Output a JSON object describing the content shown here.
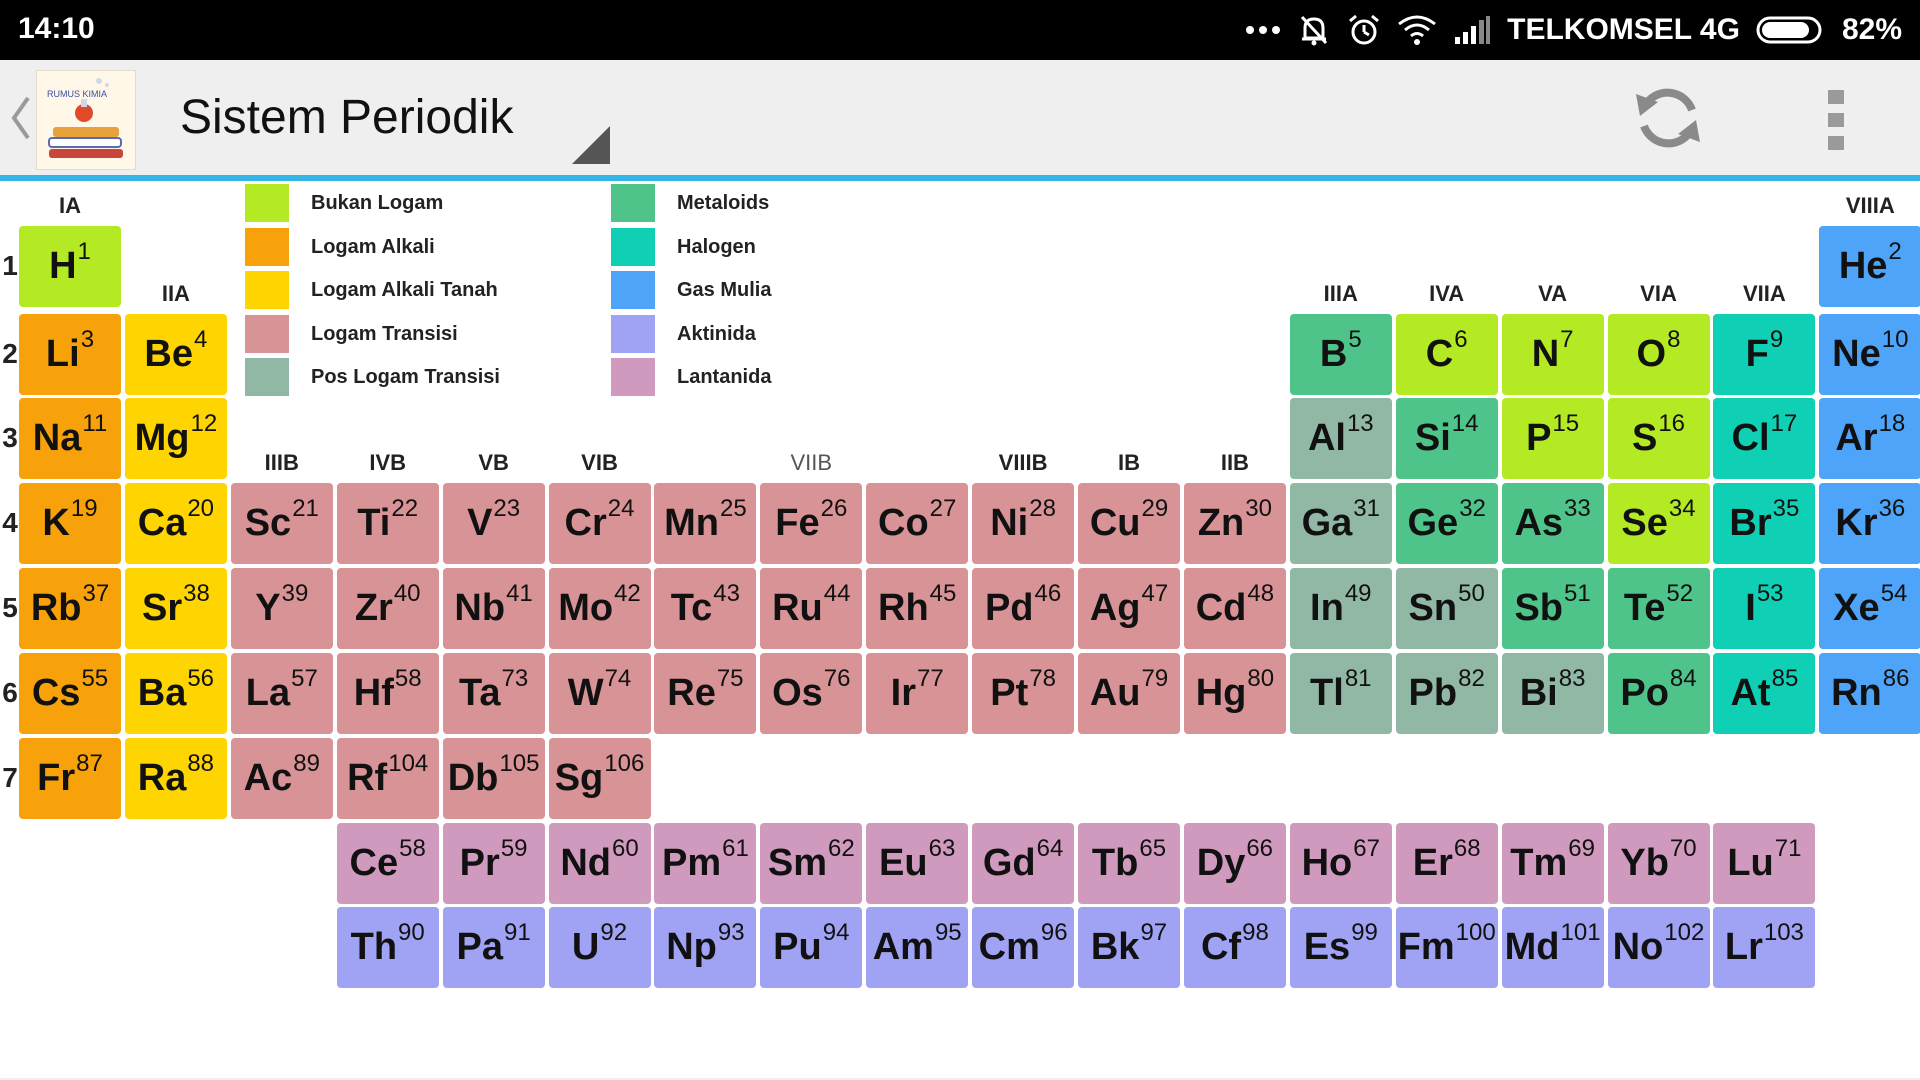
{
  "status_bar": {
    "time": "14:10",
    "carrier": "TELKOMSEL 4G",
    "battery": "82%",
    "icons": [
      "more-dots-icon",
      "mute-bell-icon",
      "alarm-icon",
      "wifi-icon",
      "signal-icon",
      "battery-icon"
    ]
  },
  "action_bar": {
    "title": "Sistem Periodik",
    "logo_text": "RUMUS KIMIA",
    "icons": [
      "back-chevron-icon",
      "app-logo",
      "spinner-triangle-icon",
      "refresh-icon",
      "overflow-menu-icon"
    ]
  },
  "colors": {
    "nonmetal": "#b4ea23",
    "alkali": "#f7a20a",
    "alkaline": "#fed401",
    "transition": "#d89396",
    "post": "#91b8a5",
    "metalloid": "#4fc48a",
    "halogen": "#0fd0b4",
    "noble": "#4ea4f8",
    "actinide": "#a0a2f4",
    "lanthanide": "#d09abe",
    "accent": "#33b5e5"
  },
  "legend": [
    {
      "key": "nonmetal",
      "label": "Bukan Logam"
    },
    {
      "key": "alkali",
      "label": "Logam Alkali"
    },
    {
      "key": "alkaline",
      "label": "Logam Alkali Tanah"
    },
    {
      "key": "transition",
      "label": "Logam Transisi"
    },
    {
      "key": "post",
      "label": "Pos Logam Transisi"
    },
    {
      "key": "metalloid",
      "label": "Metaloids"
    },
    {
      "key": "halogen",
      "label": "Halogen"
    },
    {
      "key": "noble",
      "label": "Gas Mulia"
    },
    {
      "key": "actinide",
      "label": "Aktinida"
    },
    {
      "key": "lanthanide",
      "label": "Lantanida"
    }
  ],
  "group_labels": [
    {
      "col": 1,
      "row": 1,
      "label": "IA"
    },
    {
      "col": 2,
      "row": 2,
      "label": "IIA"
    },
    {
      "col": 3,
      "row": 4,
      "label": "IIIB"
    },
    {
      "col": 4,
      "row": 4,
      "label": "IVB"
    },
    {
      "col": 5,
      "row": 4,
      "label": "VB"
    },
    {
      "col": 6,
      "row": 4,
      "label": "VIB"
    },
    {
      "col": 8,
      "row": 4,
      "label": "VIIB"
    },
    {
      "col": 10,
      "row": 4,
      "label": "VIIIB"
    },
    {
      "col": 11,
      "row": 4,
      "label": "IB"
    },
    {
      "col": 12,
      "row": 4,
      "label": "IIB"
    },
    {
      "col": 13,
      "row": 2,
      "label": "IIIA"
    },
    {
      "col": 14,
      "row": 2,
      "label": "IVA"
    },
    {
      "col": 15,
      "row": 2,
      "label": "VA"
    },
    {
      "col": 16,
      "row": 2,
      "label": "VIA"
    },
    {
      "col": 17,
      "row": 2,
      "label": "VIIA"
    },
    {
      "col": 18,
      "row": 1,
      "label": "VIIIA"
    }
  ],
  "periods": [
    "1",
    "2",
    "3",
    "4",
    "5",
    "6",
    "7"
  ],
  "elements": [
    {
      "s": "H",
      "n": 1,
      "col": 1,
      "row": 1,
      "c": "nonmetal"
    },
    {
      "s": "He",
      "n": 2,
      "col": 18,
      "row": 1,
      "c": "noble"
    },
    {
      "s": "Li",
      "n": 3,
      "col": 1,
      "row": 2,
      "c": "alkali"
    },
    {
      "s": "Be",
      "n": 4,
      "col": 2,
      "row": 2,
      "c": "alkaline"
    },
    {
      "s": "B",
      "n": 5,
      "col": 13,
      "row": 2,
      "c": "metalloid"
    },
    {
      "s": "C",
      "n": 6,
      "col": 14,
      "row": 2,
      "c": "nonmetal"
    },
    {
      "s": "N",
      "n": 7,
      "col": 15,
      "row": 2,
      "c": "nonmetal"
    },
    {
      "s": "O",
      "n": 8,
      "col": 16,
      "row": 2,
      "c": "nonmetal"
    },
    {
      "s": "F",
      "n": 9,
      "col": 17,
      "row": 2,
      "c": "halogen"
    },
    {
      "s": "Ne",
      "n": 10,
      "col": 18,
      "row": 2,
      "c": "noble"
    },
    {
      "s": "Na",
      "n": 11,
      "col": 1,
      "row": 3,
      "c": "alkali"
    },
    {
      "s": "Mg",
      "n": 12,
      "col": 2,
      "row": 3,
      "c": "alkaline"
    },
    {
      "s": "Al",
      "n": 13,
      "col": 13,
      "row": 3,
      "c": "post"
    },
    {
      "s": "Si",
      "n": 14,
      "col": 14,
      "row": 3,
      "c": "metalloid"
    },
    {
      "s": "P",
      "n": 15,
      "col": 15,
      "row": 3,
      "c": "nonmetal"
    },
    {
      "s": "S",
      "n": 16,
      "col": 16,
      "row": 3,
      "c": "nonmetal"
    },
    {
      "s": "Cl",
      "n": 17,
      "col": 17,
      "row": 3,
      "c": "halogen"
    },
    {
      "s": "Ar",
      "n": 18,
      "col": 18,
      "row": 3,
      "c": "noble"
    },
    {
      "s": "K",
      "n": 19,
      "col": 1,
      "row": 4,
      "c": "alkali"
    },
    {
      "s": "Ca",
      "n": 20,
      "col": 2,
      "row": 4,
      "c": "alkaline"
    },
    {
      "s": "Sc",
      "n": 21,
      "col": 3,
      "row": 4,
      "c": "transition"
    },
    {
      "s": "Ti",
      "n": 22,
      "col": 4,
      "row": 4,
      "c": "transition"
    },
    {
      "s": "V",
      "n": 23,
      "col": 5,
      "row": 4,
      "c": "transition"
    },
    {
      "s": "Cr",
      "n": 24,
      "col": 6,
      "row": 4,
      "c": "transition"
    },
    {
      "s": "Mn",
      "n": 25,
      "col": 7,
      "row": 4,
      "c": "transition"
    },
    {
      "s": "Fe",
      "n": 26,
      "col": 8,
      "row": 4,
      "c": "transition"
    },
    {
      "s": "Co",
      "n": 27,
      "col": 9,
      "row": 4,
      "c": "transition"
    },
    {
      "s": "Ni",
      "n": 28,
      "col": 10,
      "row": 4,
      "c": "transition"
    },
    {
      "s": "Cu",
      "n": 29,
      "col": 11,
      "row": 4,
      "c": "transition"
    },
    {
      "s": "Zn",
      "n": 30,
      "col": 12,
      "row": 4,
      "c": "transition"
    },
    {
      "s": "Ga",
      "n": 31,
      "col": 13,
      "row": 4,
      "c": "post"
    },
    {
      "s": "Ge",
      "n": 32,
      "col": 14,
      "row": 4,
      "c": "metalloid"
    },
    {
      "s": "As",
      "n": 33,
      "col": 15,
      "row": 4,
      "c": "metalloid"
    },
    {
      "s": "Se",
      "n": 34,
      "col": 16,
      "row": 4,
      "c": "nonmetal"
    },
    {
      "s": "Br",
      "n": 35,
      "col": 17,
      "row": 4,
      "c": "halogen"
    },
    {
      "s": "Kr",
      "n": 36,
      "col": 18,
      "row": 4,
      "c": "noble"
    },
    {
      "s": "Rb",
      "n": 37,
      "col": 1,
      "row": 5,
      "c": "alkali"
    },
    {
      "s": "Sr",
      "n": 38,
      "col": 2,
      "row": 5,
      "c": "alkaline"
    },
    {
      "s": "Y",
      "n": 39,
      "col": 3,
      "row": 5,
      "c": "transition"
    },
    {
      "s": "Zr",
      "n": 40,
      "col": 4,
      "row": 5,
      "c": "transition"
    },
    {
      "s": "Nb",
      "n": 41,
      "col": 5,
      "row": 5,
      "c": "transition"
    },
    {
      "s": "Mo",
      "n": 42,
      "col": 6,
      "row": 5,
      "c": "transition"
    },
    {
      "s": "Tc",
      "n": 43,
      "col": 7,
      "row": 5,
      "c": "transition"
    },
    {
      "s": "Ru",
      "n": 44,
      "col": 8,
      "row": 5,
      "c": "transition"
    },
    {
      "s": "Rh",
      "n": 45,
      "col": 9,
      "row": 5,
      "c": "transition"
    },
    {
      "s": "Pd",
      "n": 46,
      "col": 10,
      "row": 5,
      "c": "transition"
    },
    {
      "s": "Ag",
      "n": 47,
      "col": 11,
      "row": 5,
      "c": "transition"
    },
    {
      "s": "Cd",
      "n": 48,
      "col": 12,
      "row": 5,
      "c": "transition"
    },
    {
      "s": "In",
      "n": 49,
      "col": 13,
      "row": 5,
      "c": "post"
    },
    {
      "s": "Sn",
      "n": 50,
      "col": 14,
      "row": 5,
      "c": "post"
    },
    {
      "s": "Sb",
      "n": 51,
      "col": 15,
      "row": 5,
      "c": "metalloid"
    },
    {
      "s": "Te",
      "n": 52,
      "col": 16,
      "row": 5,
      "c": "metalloid"
    },
    {
      "s": "I",
      "n": 53,
      "col": 17,
      "row": 5,
      "c": "halogen"
    },
    {
      "s": "Xe",
      "n": 54,
      "col": 18,
      "row": 5,
      "c": "noble"
    },
    {
      "s": "Cs",
      "n": 55,
      "col": 1,
      "row": 6,
      "c": "alkali"
    },
    {
      "s": "Ba",
      "n": 56,
      "col": 2,
      "row": 6,
      "c": "alkaline"
    },
    {
      "s": "La",
      "n": 57,
      "col": 3,
      "row": 6,
      "c": "transition"
    },
    {
      "s": "Hf",
      "n": 58,
      "col": 4,
      "row": 6,
      "c": "transition"
    },
    {
      "s": "Ta",
      "n": 73,
      "col": 5,
      "row": 6,
      "c": "transition"
    },
    {
      "s": "W",
      "n": 74,
      "col": 6,
      "row": 6,
      "c": "transition"
    },
    {
      "s": "Re",
      "n": 75,
      "col": 7,
      "row": 6,
      "c": "transition"
    },
    {
      "s": "Os",
      "n": 76,
      "col": 8,
      "row": 6,
      "c": "transition"
    },
    {
      "s": "Ir",
      "n": 77,
      "col": 9,
      "row": 6,
      "c": "transition"
    },
    {
      "s": "Pt",
      "n": 78,
      "col": 10,
      "row": 6,
      "c": "transition"
    },
    {
      "s": "Au",
      "n": 79,
      "col": 11,
      "row": 6,
      "c": "transition"
    },
    {
      "s": "Hg",
      "n": 80,
      "col": 12,
      "row": 6,
      "c": "transition"
    },
    {
      "s": "Tl",
      "n": 81,
      "col": 13,
      "row": 6,
      "c": "post"
    },
    {
      "s": "Pb",
      "n": 82,
      "col": 14,
      "row": 6,
      "c": "post"
    },
    {
      "s": "Bi",
      "n": 83,
      "col": 15,
      "row": 6,
      "c": "post"
    },
    {
      "s": "Po",
      "n": 84,
      "col": 16,
      "row": 6,
      "c": "metalloid"
    },
    {
      "s": "At",
      "n": 85,
      "col": 17,
      "row": 6,
      "c": "halogen"
    },
    {
      "s": "Rn",
      "n": 86,
      "col": 18,
      "row": 6,
      "c": "noble"
    },
    {
      "s": "Fr",
      "n": 87,
      "col": 1,
      "row": 7,
      "c": "alkali"
    },
    {
      "s": "Ra",
      "n": 88,
      "col": 2,
      "row": 7,
      "c": "alkaline"
    },
    {
      "s": "Ac",
      "n": 89,
      "col": 3,
      "row": 7,
      "c": "transition"
    },
    {
      "s": "Rf",
      "n": 104,
      "col": 4,
      "row": 7,
      "c": "transition"
    },
    {
      "s": "Db",
      "n": 105,
      "col": 5,
      "row": 7,
      "c": "transition"
    },
    {
      "s": "Sg",
      "n": 106,
      "col": 6,
      "row": 7,
      "c": "transition"
    },
    {
      "s": "Ce",
      "n": 58,
      "col": 4,
      "row": 8,
      "c": "lanthanide"
    },
    {
      "s": "Pr",
      "n": 59,
      "col": 5,
      "row": 8,
      "c": "lanthanide"
    },
    {
      "s": "Nd",
      "n": 60,
      "col": 6,
      "row": 8,
      "c": "lanthanide"
    },
    {
      "s": "Pm",
      "n": 61,
      "col": 7,
      "row": 8,
      "c": "lanthanide"
    },
    {
      "s": "Sm",
      "n": 62,
      "col": 8,
      "row": 8,
      "c": "lanthanide"
    },
    {
      "s": "Eu",
      "n": 63,
      "col": 9,
      "row": 8,
      "c": "lanthanide"
    },
    {
      "s": "Gd",
      "n": 64,
      "col": 10,
      "row": 8,
      "c": "lanthanide"
    },
    {
      "s": "Tb",
      "n": 65,
      "col": 11,
      "row": 8,
      "c": "lanthanide"
    },
    {
      "s": "Dy",
      "n": 66,
      "col": 12,
      "row": 8,
      "c": "lanthanide"
    },
    {
      "s": "Ho",
      "n": 67,
      "col": 13,
      "row": 8,
      "c": "lanthanide"
    },
    {
      "s": "Er",
      "n": 68,
      "col": 14,
      "row": 8,
      "c": "lanthanide"
    },
    {
      "s": "Tm",
      "n": 69,
      "col": 15,
      "row": 8,
      "c": "lanthanide"
    },
    {
      "s": "Yb",
      "n": 70,
      "col": 16,
      "row": 8,
      "c": "lanthanide"
    },
    {
      "s": "Lu",
      "n": 71,
      "col": 17,
      "row": 8,
      "c": "lanthanide"
    },
    {
      "s": "Th",
      "n": 90,
      "col": 4,
      "row": 9,
      "c": "actinide"
    },
    {
      "s": "Pa",
      "n": 91,
      "col": 5,
      "row": 9,
      "c": "actinide"
    },
    {
      "s": "U",
      "n": 92,
      "col": 6,
      "row": 9,
      "c": "actinide"
    },
    {
      "s": "Np",
      "n": 93,
      "col": 7,
      "row": 9,
      "c": "actinide"
    },
    {
      "s": "Pu",
      "n": 94,
      "col": 8,
      "row": 9,
      "c": "actinide"
    },
    {
      "s": "Am",
      "n": 95,
      "col": 9,
      "row": 9,
      "c": "actinide"
    },
    {
      "s": "Cm",
      "n": 96,
      "col": 10,
      "row": 9,
      "c": "actinide"
    },
    {
      "s": "Bk",
      "n": 97,
      "col": 11,
      "row": 9,
      "c": "actinide"
    },
    {
      "s": "Cf",
      "n": 98,
      "col": 12,
      "row": 9,
      "c": "actinide"
    },
    {
      "s": "Es",
      "n": 99,
      "col": 13,
      "row": 9,
      "c": "actinide"
    },
    {
      "s": "Fm",
      "n": 100,
      "col": 14,
      "row": 9,
      "c": "actinide"
    },
    {
      "s": "Md",
      "n": 101,
      "col": 15,
      "row": 9,
      "c": "actinide"
    },
    {
      "s": "No",
      "n": 102,
      "col": 16,
      "row": 9,
      "c": "actinide"
    },
    {
      "s": "Lr",
      "n": 103,
      "col": 17,
      "row": 9,
      "c": "actinide"
    }
  ]
}
